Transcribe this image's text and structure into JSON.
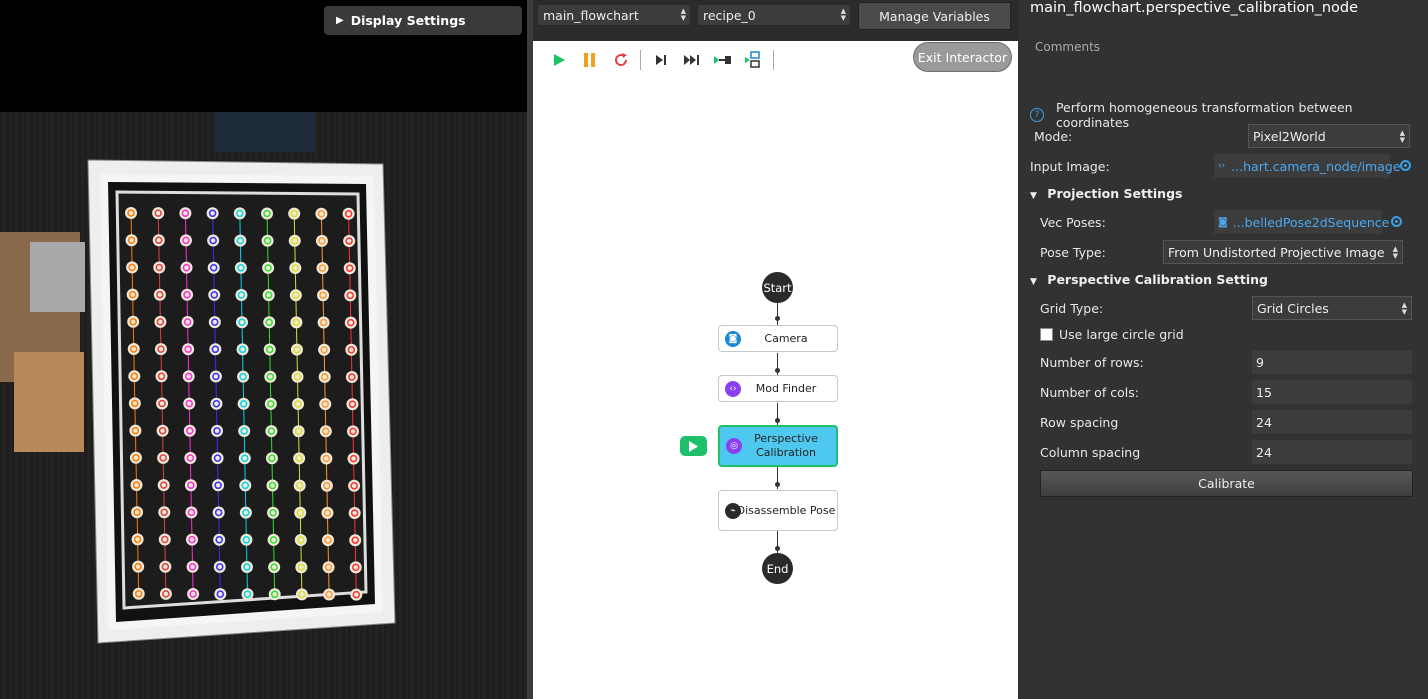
{
  "viewer": {
    "display_settings_label": "Display Settings"
  },
  "editor": {
    "flowchart_select": "main_flowchart",
    "recipe_select": "recipe_0",
    "manage_variables_label": "Manage Variables",
    "exit_interactor_label": "Exit Interactor",
    "toolbar_icons": [
      "play-icon",
      "pause-icon",
      "restart-icon",
      "step-icon",
      "fast-forward-icon",
      "run-to-node-icon",
      "run-node-icon"
    ],
    "nodes": {
      "start": "Start",
      "camera": "Camera",
      "mod_finder": "Mod Finder",
      "perspective_calibration": "Perspective Calibration",
      "disassemble_pose": "Disassemble Pose",
      "end": "End"
    },
    "active_node": "perspective_calibration",
    "colors": {
      "active_fill": "#4ec8ef",
      "active_border": "#1fc06a",
      "camera_icon": "#1a8ad4",
      "mod_finder_icon": "#8a3ff0",
      "perspective_icon": "#8a3ff0",
      "disassemble_icon": "#2a2a2a"
    }
  },
  "properties": {
    "title": "main_flowchart.perspective_calibration_node",
    "comments_label": "Comments",
    "description": "Perform homogeneous transformation between coordinates",
    "mode_label": "Mode:",
    "mode_value": "Pixel2World",
    "input_image_label": "Input Image:",
    "input_image_value": "...hart.camera_node/image",
    "projection_section": "Projection Settings",
    "vec_poses_label": "Vec Poses:",
    "vec_poses_value": "...belledPose2dSequence",
    "pose_type_label": "Pose Type:",
    "pose_type_value": "From Undistorted Projective Image",
    "calibration_section": "Perspective Calibration Setting",
    "grid_type_label": "Grid Type:",
    "grid_type_value": "Grid Circles",
    "large_grid_label": "Use large circle grid",
    "large_grid_checked": false,
    "rows_label": "Number of rows:",
    "rows_value": "9",
    "cols_label": "Number of cols:",
    "cols_value": "15",
    "row_spacing_label": "Row spacing",
    "row_spacing_value": "24",
    "col_spacing_label": "Column spacing",
    "col_spacing_value": "24",
    "calibrate_label": "Calibrate",
    "accent_color": "#3aa0e8"
  }
}
